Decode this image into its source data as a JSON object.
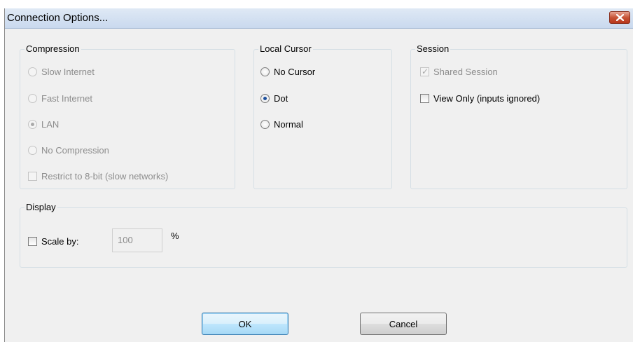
{
  "window": {
    "title": "Connection Options...",
    "close_icon": "close-icon"
  },
  "compression": {
    "title": "Compression",
    "options": [
      {
        "label": "Slow Internet",
        "selected": false,
        "enabled": false
      },
      {
        "label": "Fast Internet",
        "selected": false,
        "enabled": false
      },
      {
        "label": "LAN",
        "selected": true,
        "enabled": false
      },
      {
        "label": "No Compression",
        "selected": false,
        "enabled": false
      }
    ],
    "restrict_label": "Restrict to 8-bit (slow networks)",
    "restrict_checked": false,
    "restrict_enabled": false
  },
  "local_cursor": {
    "title": "Local Cursor",
    "options": [
      {
        "label": "No Cursor",
        "selected": false
      },
      {
        "label": "Dot",
        "selected": true
      },
      {
        "label": "Normal",
        "selected": false
      }
    ]
  },
  "session": {
    "title": "Session",
    "shared_label": "Shared Session",
    "shared_checked": true,
    "shared_enabled": false,
    "view_only_label": "View Only (inputs ignored)",
    "view_only_checked": false
  },
  "display": {
    "title": "Display",
    "scale_label": "Scale by:",
    "scale_checked": false,
    "scale_value": "100",
    "unit": "%"
  },
  "buttons": {
    "ok": "OK",
    "cancel": "Cancel"
  }
}
